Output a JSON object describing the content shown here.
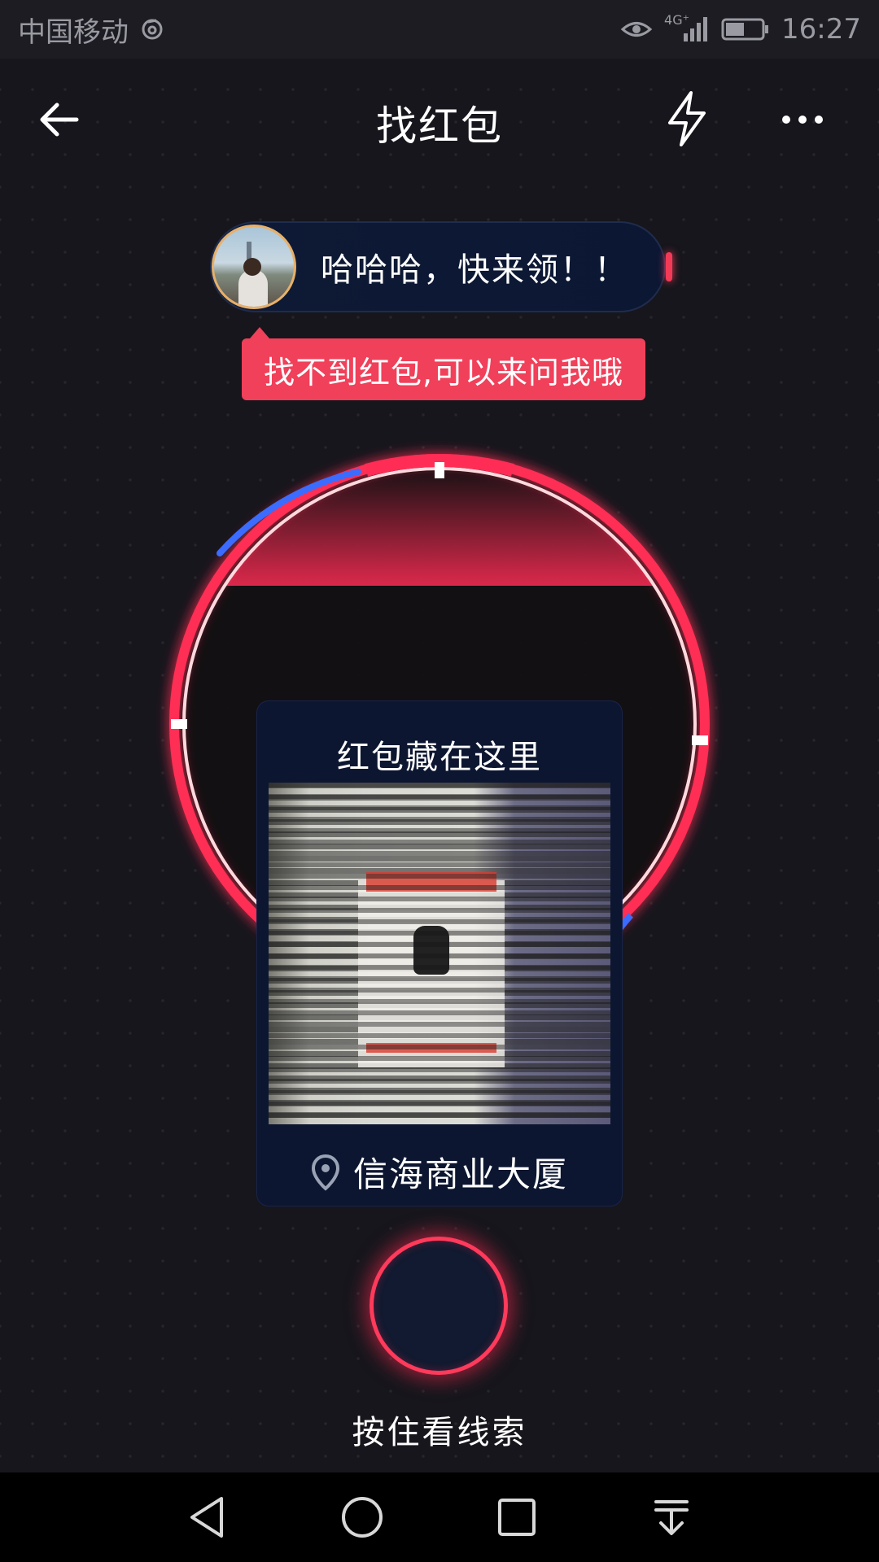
{
  "status_bar": {
    "carrier": "中国移动",
    "network": "4G⁺",
    "time": "16:27",
    "battery_level": 0.5
  },
  "header": {
    "title": "找红包"
  },
  "message": {
    "text": "哈哈哈，快来领！！"
  },
  "hint": {
    "text": "找不到红包,可以来问我哦"
  },
  "clue_card": {
    "title": "红包藏在这里",
    "location": "信海商业大厦"
  },
  "hold_button": {
    "label": "按住看线索"
  },
  "colors": {
    "accent": "#f0405a",
    "ring_red": "#ff2d55",
    "ring_blue": "#3b6cff",
    "background": "#16161c",
    "card": "#0c1630"
  },
  "icons": [
    "back-arrow-icon",
    "flash-icon",
    "more-icon",
    "location-pin-icon",
    "nav-back-icon",
    "nav-home-icon",
    "nav-recents-icon",
    "nav-notifications-icon"
  ]
}
